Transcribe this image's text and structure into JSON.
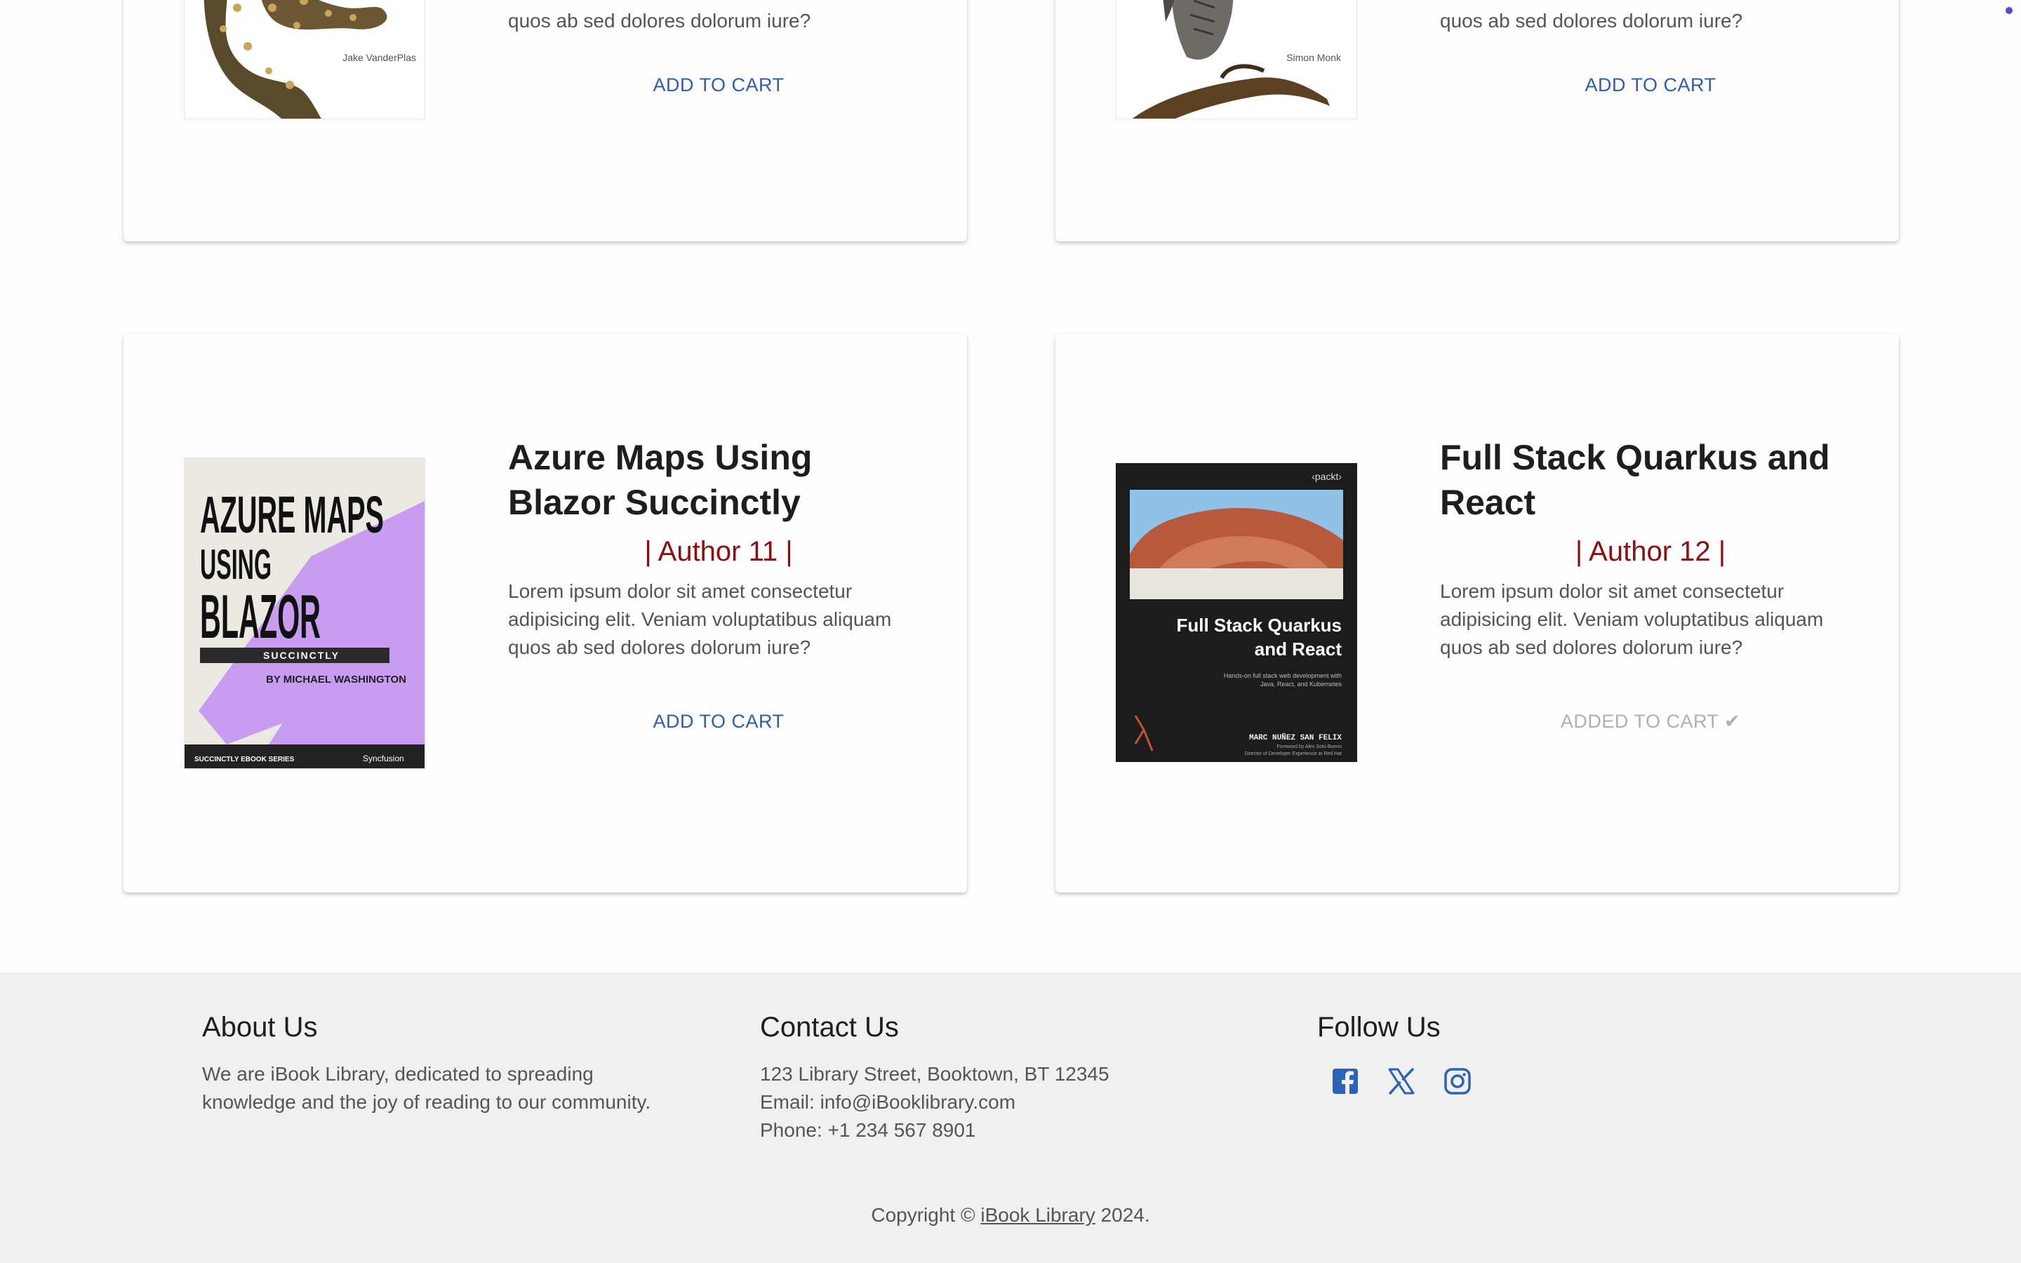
{
  "books": [
    {
      "cover_caption": "Jake VanderPlas",
      "desc_tail": "quos ab sed dolores dolorum iure?",
      "cart_label": "ADD TO CART"
    },
    {
      "cover_caption": "Simon Monk",
      "desc_tail": "quos ab sed dolores dolorum iure?",
      "cart_label": "ADD TO CART"
    },
    {
      "title": "Azure Maps Using Blazor Succinctly",
      "author": "| Author 11 |",
      "description": "Lorem ipsum dolor sit amet consectetur adipisicing elit. Veniam voluptatibus aliquam quos ab sed dolores dolorum iure?",
      "cart_label": "ADD TO CART",
      "cover": {
        "line1": "AZURE MAPS",
        "line2": "USING",
        "line3": "BLAZOR",
        "badge": "SUCCINCTLY",
        "byline": "BY MICHAEL WASHINGTON",
        "series": "SUCCINCTLY EBOOK SERIES",
        "publisher": "Syncfusion"
      }
    },
    {
      "title": "Full Stack Quarkus and React",
      "author": "| Author 12 |",
      "description": "Lorem ipsum dolor sit amet consectetur adipisicing elit. Veniam voluptatibus aliquam quos ab sed dolores dolorum iure?",
      "cart_label": "ADDED TO CART ✔",
      "cover": {
        "publisher": "‹packt›",
        "title_line1": "Full Stack Quarkus",
        "title_line2": "and React",
        "subtitle_line1": "Hands-on full stack web development with",
        "subtitle_line2": "Java, React, and Kubernetes",
        "author": "MARC NUÑEZ SAN FELIX",
        "foreword_line1": "Foreword by Alex Soto Bueno",
        "foreword_line2": "Director of Developer Experience at Red Hat"
      }
    }
  ],
  "footer": {
    "about": {
      "heading": "About Us",
      "line1": "We are iBook Library, dedicated to spreading",
      "line2": "knowledge and the joy of reading to our community."
    },
    "contact": {
      "heading": "Contact Us",
      "address": "123 Library Street, Booktown, BT 12345",
      "email": "Email: info@iBooklibrary.com",
      "phone": "Phone: +1 234 567 8901"
    },
    "follow": {
      "heading": "Follow Us",
      "icons": [
        "facebook-icon",
        "x-twitter-icon",
        "instagram-icon"
      ]
    },
    "copyright_prefix": "Copyright ©",
    "copyright_link": "iBook Library",
    "copyright_suffix": "2024."
  },
  "colors": {
    "author": "#8b1010",
    "link": "#2f5db3",
    "added": "#b0b0b0",
    "social": "#2b63b8",
    "footer_bg": "#f0f0f0"
  }
}
